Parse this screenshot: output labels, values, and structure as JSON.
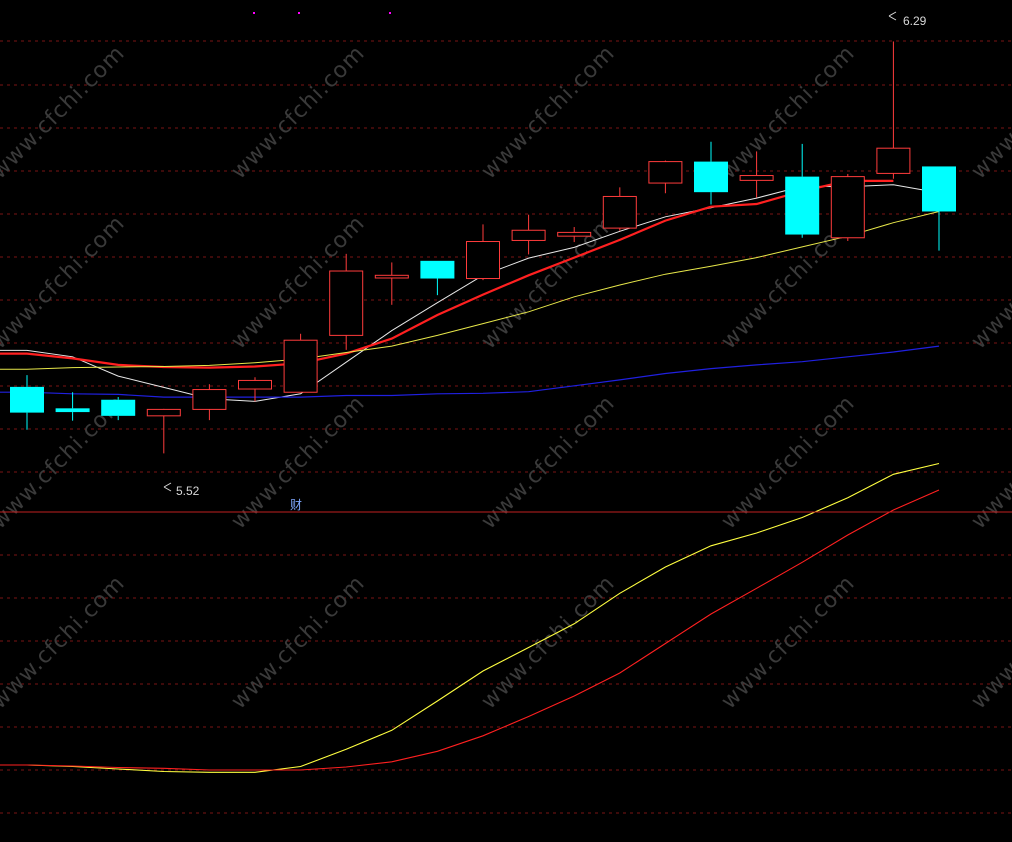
{
  "watermark": "www.cfchi.com",
  "colors": {
    "background": "#000000",
    "grid": "#7a1414",
    "divider": "#c02020",
    "up": "#ff3c3c",
    "down": "#00ffff",
    "ma_white": "#e8e8e8",
    "ma_red": "#ff2020",
    "ma_yellow": "#e8e84a",
    "ma_blue": "#2020e0",
    "ind_yellow": "#ffff40",
    "ind_red": "#ff2020",
    "marker": "#7fa8ff",
    "top_dots": "#ff00ff"
  },
  "annotations": {
    "high_label": "6.29",
    "low_label": "5.52",
    "event_marker": "财"
  },
  "chart_data": [
    {
      "type": "candlestick",
      "title": "",
      "price_range": [
        5.45,
        6.33
      ],
      "grid": true,
      "candles": [
        {
          "o": 5.646,
          "h": 5.668,
          "l": 5.566,
          "c": 5.598
        },
        {
          "o": 5.606,
          "h": 5.636,
          "l": 5.583,
          "c": 5.599
        },
        {
          "o": 5.622,
          "h": 5.627,
          "l": 5.584,
          "c": 5.592
        },
        {
          "o": 5.592,
          "h": 5.605,
          "l": 5.522,
          "c": 5.604
        },
        {
          "o": 5.604,
          "h": 5.651,
          "l": 5.584,
          "c": 5.641
        },
        {
          "o": 5.642,
          "h": 5.664,
          "l": 5.619,
          "c": 5.658
        },
        {
          "o": 5.636,
          "h": 5.745,
          "l": 5.636,
          "c": 5.733
        },
        {
          "o": 5.742,
          "h": 5.894,
          "l": 5.715,
          "c": 5.862
        },
        {
          "o": 5.849,
          "h": 5.878,
          "l": 5.799,
          "c": 5.854
        },
        {
          "o": 5.881,
          "h": 5.881,
          "l": 5.817,
          "c": 5.848
        },
        {
          "o": 5.848,
          "h": 5.949,
          "l": 5.845,
          "c": 5.917
        },
        {
          "o": 5.919,
          "h": 5.967,
          "l": 5.893,
          "c": 5.938
        },
        {
          "o": 5.927,
          "h": 5.944,
          "l": 5.916,
          "c": 5.934
        },
        {
          "o": 5.942,
          "h": 6.018,
          "l": 5.937,
          "c": 6.001
        },
        {
          "o": 6.026,
          "h": 6.068,
          "l": 6.007,
          "c": 6.066
        },
        {
          "o": 6.066,
          "h": 6.103,
          "l": 5.986,
          "c": 6.009
        },
        {
          "o": 6.031,
          "h": 6.085,
          "l": 5.999,
          "c": 6.04
        },
        {
          "o": 6.038,
          "h": 6.099,
          "l": 5.924,
          "c": 5.93
        },
        {
          "o": 5.924,
          "h": 6.043,
          "l": 5.918,
          "c": 6.038
        },
        {
          "o": 6.044,
          "h": 6.29,
          "l": 6.034,
          "c": 6.091
        },
        {
          "o": 6.057,
          "h": 6.057,
          "l": 5.9,
          "c": 5.973
        }
      ],
      "moving_averages": [
        {
          "color": "#e8e8e8",
          "width": 1.0,
          "values": [
            5.714,
            5.702,
            5.666,
            5.645,
            5.624,
            5.619,
            5.633,
            5.692,
            5.751,
            5.803,
            5.854,
            5.886,
            5.906,
            5.936,
            5.963,
            5.98,
            5.998,
            6.02,
            6.019,
            6.023,
            6.008
          ]
        },
        {
          "color": "#ff2020",
          "width": 2.2,
          "values": [
            5.708,
            5.699,
            5.687,
            5.683,
            5.682,
            5.684,
            5.69,
            5.708,
            5.736,
            5.78,
            5.818,
            5.854,
            5.887,
            5.92,
            5.956,
            5.982,
            5.987,
            6.011,
            6.03,
            6.03,
            null
          ]
        },
        {
          "color": "#e8e84a",
          "width": 1.0,
          "values": [
            5.679,
            5.682,
            5.683,
            5.684,
            5.686,
            5.691,
            5.698,
            5.71,
            5.722,
            5.742,
            5.764,
            5.786,
            5.814,
            5.836,
            5.856,
            5.871,
            5.887,
            5.907,
            5.927,
            5.952,
            5.973
          ]
        },
        {
          "color": "#2020e0",
          "width": 1.2,
          "values": [
            5.636,
            5.633,
            5.632,
            5.627,
            5.627,
            5.627,
            5.627,
            5.63,
            5.63,
            5.633,
            5.634,
            5.637,
            5.648,
            5.659,
            5.671,
            5.68,
            5.687,
            5.693,
            5.702,
            5.711,
            5.722
          ]
        }
      ]
    },
    {
      "type": "line",
      "title": "",
      "y_range": [
        0.0,
        1.0
      ],
      "grid": true,
      "x": [
        0,
        1,
        2,
        3,
        4,
        5,
        6,
        7,
        8,
        9,
        10,
        11,
        12,
        13,
        14,
        15,
        16,
        17,
        18,
        19,
        20
      ],
      "series": [
        {
          "color": "#ffff40",
          "values": [
            0.08,
            0.074,
            0.064,
            0.054,
            0.051,
            0.051,
            0.074,
            0.143,
            0.219,
            0.336,
            0.456,
            0.55,
            0.645,
            0.767,
            0.872,
            0.957,
            1.008,
            1.07,
            1.149,
            1.243,
            1.286
          ]
        },
        {
          "color": "#ff2020",
          "values": [
            0.08,
            0.076,
            0.07,
            0.067,
            0.06,
            0.06,
            0.06,
            0.072,
            0.093,
            0.135,
            0.197,
            0.274,
            0.356,
            0.448,
            0.566,
            0.684,
            0.787,
            0.891,
            1.0,
            1.1,
            1.18
          ]
        }
      ]
    }
  ]
}
